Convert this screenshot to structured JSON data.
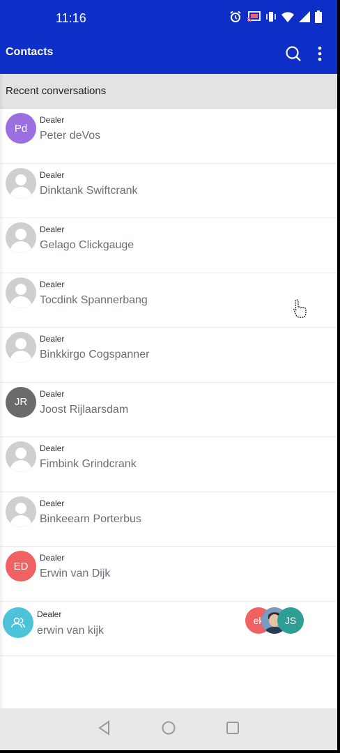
{
  "status_bar": {
    "time": "11:16",
    "icons": [
      "alarm-icon",
      "cast-icon",
      "vibrate-icon",
      "wifi-icon",
      "signal-icon",
      "battery-icon"
    ]
  },
  "app_bar": {
    "title": "Contacts",
    "actions": [
      "search-icon",
      "more-vert-icon"
    ],
    "color": "#0d2fc8"
  },
  "section": {
    "title": "Recent conversations"
  },
  "contacts": [
    {
      "role": "Dealer",
      "name": "Peter deVos",
      "initials": "Pd",
      "avatar_color": "#9b6fe0"
    },
    {
      "role": "Dealer",
      "name": "Dinktank Swiftcrank",
      "initials": "",
      "avatar_color": "default"
    },
    {
      "role": "Dealer",
      "name": "Gelago Clickgauge",
      "initials": "",
      "avatar_color": "default"
    },
    {
      "role": "Dealer",
      "name": "Tocdink Spannerbang",
      "initials": "",
      "avatar_color": "default"
    },
    {
      "role": "Dealer",
      "name": "Binkkirgo Cogspanner",
      "initials": "",
      "avatar_color": "default"
    },
    {
      "role": "Dealer",
      "name": "Joost Rijlaarsdam",
      "initials": "JR",
      "avatar_color": "#6b6b6b"
    },
    {
      "role": "Dealer",
      "name": "Fimbink Grindcrank",
      "initials": "",
      "avatar_color": "default"
    },
    {
      "role": "Dealer",
      "name": "Binkeearn Porterbus",
      "initials": "",
      "avatar_color": "default"
    },
    {
      "role": "Dealer",
      "name": "Erwin van Dijk",
      "initials": "ED",
      "avatar_color": "#f06262"
    },
    {
      "role": "Dealer",
      "name": "erwin van kijk",
      "initials": "",
      "avatar_color": "#4cc3d9",
      "group": true,
      "participants": [
        {
          "initials": "ek",
          "color": "#f06262"
        },
        {
          "initials": "",
          "color": "#5a7fa8",
          "photo": true
        },
        {
          "initials": "JS",
          "color": "#2e9e94"
        }
      ]
    }
  ],
  "nav_bar": {
    "buttons": [
      "back-icon",
      "home-icon",
      "recents-icon"
    ]
  }
}
